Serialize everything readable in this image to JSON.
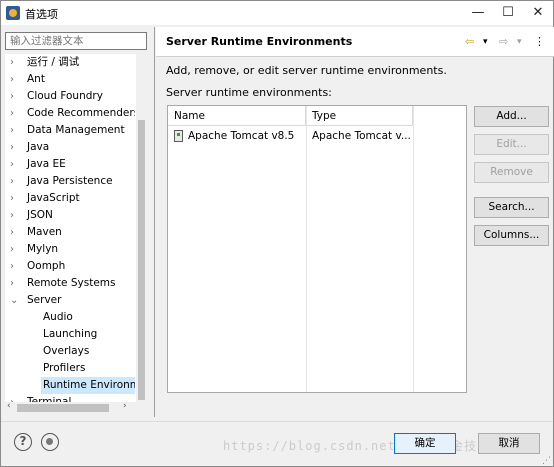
{
  "window": {
    "title": "首选项",
    "minimize_glyph": "—",
    "maximize_glyph": "☐",
    "close_glyph": "✕"
  },
  "filter": {
    "placeholder": "输入过滤器文本"
  },
  "tree": {
    "items": [
      {
        "label": "运行 / 调试",
        "twisty": "›"
      },
      {
        "label": "Ant",
        "twisty": "›"
      },
      {
        "label": "Cloud Foundry",
        "twisty": "›"
      },
      {
        "label": "Code Recommenders",
        "twisty": "›"
      },
      {
        "label": "Data Management",
        "twisty": "›"
      },
      {
        "label": "Java",
        "twisty": "›"
      },
      {
        "label": "Java EE",
        "twisty": "›"
      },
      {
        "label": "Java Persistence",
        "twisty": "›"
      },
      {
        "label": "JavaScript",
        "twisty": "›"
      },
      {
        "label": "JSON",
        "twisty": "›"
      },
      {
        "label": "Maven",
        "twisty": "›"
      },
      {
        "label": "Mylyn",
        "twisty": "›"
      },
      {
        "label": "Oomph",
        "twisty": "›"
      },
      {
        "label": "Remote Systems",
        "twisty": "›"
      },
      {
        "label": "Server",
        "twisty": "⌄"
      },
      {
        "label": "Audio",
        "twisty": ""
      },
      {
        "label": "Launching",
        "twisty": ""
      },
      {
        "label": "Overlays",
        "twisty": ""
      },
      {
        "label": "Profilers",
        "twisty": ""
      },
      {
        "label": "Runtime Environm",
        "twisty": ""
      },
      {
        "label": "Terminal",
        "twisty": "›"
      }
    ],
    "scroll_left": "‹",
    "scroll_right": "›"
  },
  "page": {
    "title": "Server Runtime Environments",
    "nav_back": "⇦",
    "nav_back_menu": "▾",
    "nav_forward": "⇨",
    "nav_forward_menu": "▾",
    "view_menu": "⋮",
    "description": "Add, remove, or edit server runtime environments.",
    "list_label": "Server runtime environments:"
  },
  "table": {
    "columns": [
      "Name",
      "Type"
    ],
    "rows": [
      {
        "name": "Apache Tomcat v8.5",
        "type": "Apache Tomcat v..."
      }
    ]
  },
  "buttons": {
    "add": "Add...",
    "edit": "Edit...",
    "remove": "Remove",
    "search": "Search...",
    "columns": "Columns..."
  },
  "footer": {
    "help_glyph": "?",
    "ok": "确定",
    "cancel": "取消",
    "watermark": "https://blog.csdn.net/@稀土掘金技术社区",
    "resize_grip": "⋰"
  }
}
